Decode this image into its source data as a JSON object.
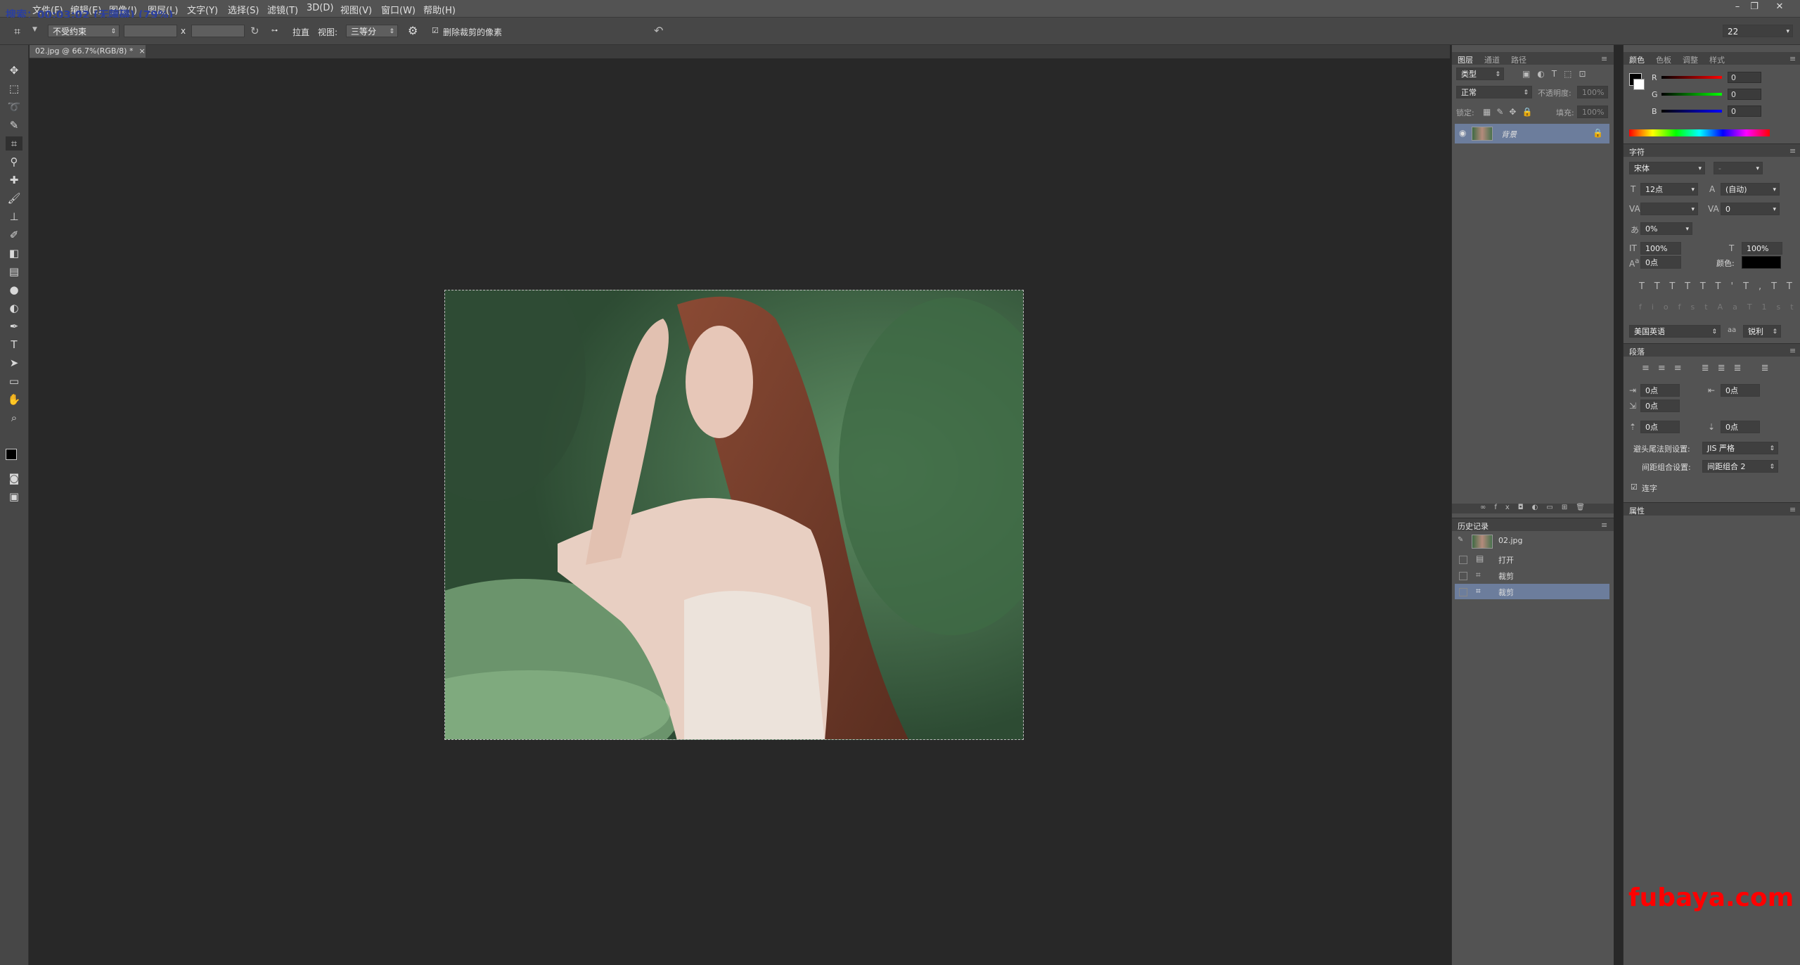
{
  "window": {
    "title_overlay": "搜索：00:03:02 (无障碍) (79%)",
    "controls": [
      "–",
      "❐",
      "✕"
    ]
  },
  "menubar": {
    "items": [
      "文件(F)",
      "编辑(E)",
      "图像(I)",
      "图层(L)",
      "文字(Y)",
      "选择(S)",
      "滤镜(T)",
      "3D(D)",
      "视图(V)",
      "窗口(W)",
      "帮助(H)"
    ]
  },
  "options_bar": {
    "constraint": "不受约束",
    "ratio_sep": "x",
    "straighten_label": "拉直",
    "view_label": "视图:",
    "view_value": "三等分",
    "delete_cropped_label": "删除裁剪的像素",
    "delete_cropped_checked": true,
    "workspace_value": "22"
  },
  "document": {
    "tab_label": "02.jpg @ 66.7%(RGB/8) *"
  },
  "layers_panel": {
    "tabs": [
      "图层",
      "通道",
      "路径"
    ],
    "kind_filter": "类型",
    "blend_mode": "正常",
    "opacity_label": "不透明度:",
    "opacity_value": "100%",
    "lock_label": "锁定:",
    "fill_label": "填充:",
    "fill_value": "100%",
    "layers": [
      {
        "name": "背景",
        "locked": true
      }
    ]
  },
  "history_panel": {
    "title": "历史记录",
    "snapshot": "02.jpg",
    "items": [
      "打开",
      "裁剪",
      "裁剪"
    ],
    "selected_index": 2
  },
  "color_panel": {
    "tabs": [
      "颜色",
      "色板",
      "调整",
      "样式"
    ],
    "channels": [
      {
        "label": "R",
        "value": "0"
      },
      {
        "label": "G",
        "value": "0"
      },
      {
        "label": "B",
        "value": "0"
      }
    ]
  },
  "character_panel": {
    "title": "字符",
    "font_family": "宋体",
    "font_style": "-",
    "font_size": "12点",
    "leading": "(自动)",
    "kerning": "",
    "tracking": "0",
    "tsume": "0%",
    "vscale": "100%",
    "hscale": "100%",
    "baseline": "0点",
    "color_label": "颜色:",
    "language": "美国英语",
    "antialias": "锐利"
  },
  "paragraph_panel": {
    "title": "段落",
    "indent_left": "0点",
    "indent_right": "0点",
    "first_line": "0点",
    "space_before": "0点",
    "space_after": "0点",
    "kinsoku_label": "避头尾法则设置:",
    "kinsoku_value": "JIS 严格",
    "mojikumi_label": "间距组合设置:",
    "mojikumi_value": "间距组合 2",
    "hyphenate_label": "连字",
    "hyphenate_checked": true
  },
  "properties_panel": {
    "title": "属性"
  },
  "watermark": "fubaya.com"
}
